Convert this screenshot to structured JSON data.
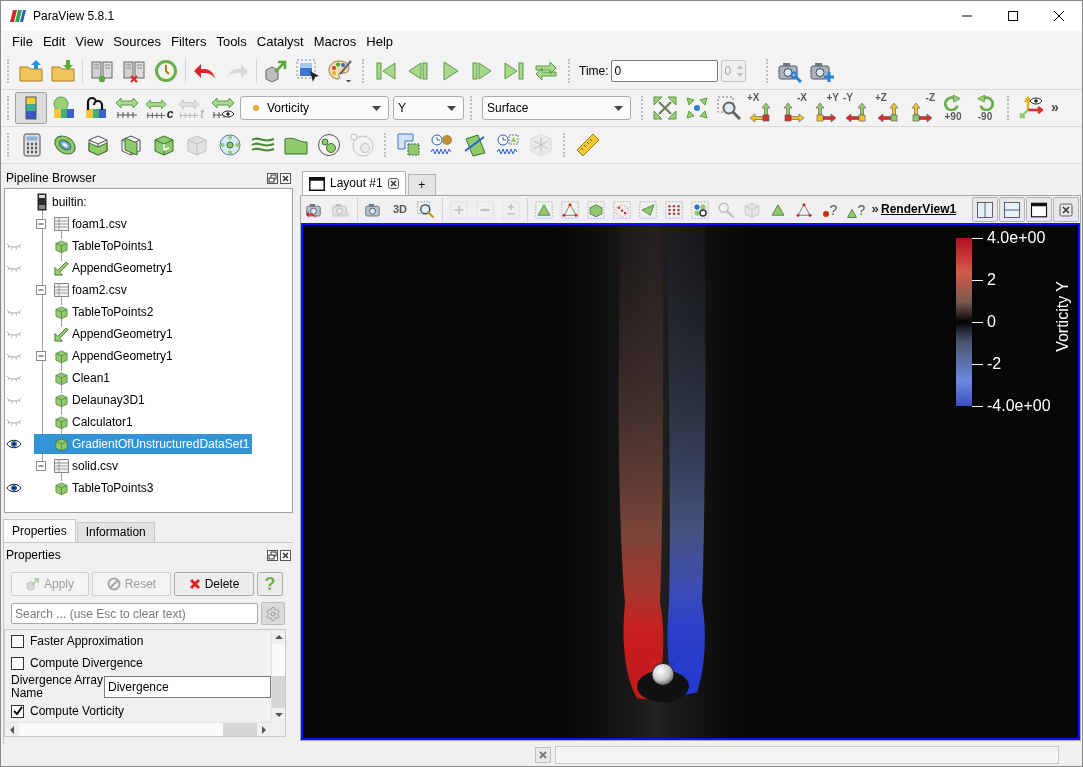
{
  "window": {
    "title": "ParaView 5.8.1"
  },
  "menu_bar": [
    "File",
    "Edit",
    "View",
    "Sources",
    "Filters",
    "Tools",
    "Catalyst",
    "Macros",
    "Help"
  ],
  "toolbar_rows": [
    {
      "toolbars": [
        {
          "groups": [
            [
              {
                "kind": "open"
              },
              {
                "kind": "save"
              }
            ],
            [
              {
                "kind": "connect"
              },
              {
                "kind": "disconnect"
              },
              {
                "kind": "autoapply"
              }
            ],
            [
              {
                "kind": "undo"
              },
              {
                "kind": "redo",
                "disabled": true
              }
            ],
            [
              {
                "kind": "export"
              },
              {
                "kind": "select"
              },
              {
                "kind": "palette"
              }
            ]
          ]
        },
        {
          "groups": [
            [
              {
                "kind": "first"
              },
              {
                "kind": "previous"
              },
              {
                "kind": "play"
              },
              {
                "kind": "next"
              },
              {
                "kind": "last"
              },
              {
                "kind": "loop"
              }
            ]
          ]
        },
        {
          "groups": [
            [
              {
                "kind": "label",
                "text": "Time:"
              },
              {
                "kind": "input",
                "value": "0"
              },
              {
                "kind": "spin",
                "value": "0",
                "disabled": true
              }
            ]
          ]
        },
        {
          "groups": [
            [
              {
                "kind": "snapshot"
              },
              {
                "kind": "snapshotadd"
              }
            ]
          ]
        }
      ]
    },
    {
      "toolbars": [
        {
          "groups": [
            [
              {
                "kind": "colormap",
                "pressed": true
              },
              {
                "kind": "legend"
              },
              {
                "kind": "editcolors"
              },
              {
                "kind": "rescale"
              },
              {
                "kind": "rescalecustom",
                "label": "c"
              },
              {
                "kind": "rescaletemporal",
                "label": "t",
                "disabled": true
              },
              {
                "kind": "rescalevisible"
              },
              {
                "kind": "array",
                "value": "Vorticity"
              },
              {
                "kind": "component",
                "value": "Y"
              }
            ]
          ]
        },
        {
          "groups": [
            [
              {
                "kind": "representation",
                "value": "Surface"
              }
            ]
          ]
        },
        {
          "groups": [
            [
              {
                "kind": "resetcamera"
              },
              {
                "kind": "zoomdata"
              },
              {
                "kind": "zoombox"
              },
              {
                "kind": "px",
                "label": "+X"
              },
              {
                "kind": "mx",
                "label": "-X"
              },
              {
                "kind": "py",
                "label": "+Y"
              },
              {
                "kind": "my",
                "label": "-Y"
              },
              {
                "kind": "pz",
                "label": "+Z"
              },
              {
                "kind": "mz",
                "label": "-Z"
              },
              {
                "kind": "rotatecw",
                "label": "+90"
              },
              {
                "kind": "rotateccw",
                "label": "-90"
              }
            ]
          ]
        },
        {
          "groups": [
            [
              {
                "kind": "axes"
              },
              {
                "kind": "more",
                "label": "»"
              }
            ]
          ]
        }
      ]
    },
    {
      "toolbars": [
        {
          "groups": [
            [
              {
                "kind": "calculator"
              },
              {
                "kind": "contour"
              },
              {
                "kind": "clip"
              },
              {
                "kind": "slice"
              },
              {
                "kind": "threshold"
              },
              {
                "kind": "subset",
                "disabled": true
              },
              {
                "kind": "glyph"
              },
              {
                "kind": "stream"
              },
              {
                "kind": "warp"
              },
              {
                "kind": "groupdata"
              },
              {
                "kind": "extractlevel",
                "disabled": true
              }
            ]
          ]
        },
        {
          "groups": [
            [
              {
                "kind": "finddata"
              },
              {
                "kind": "plottime"
              },
              {
                "kind": "plotline"
              },
              {
                "kind": "plotselection"
              },
              {
                "kind": "snowflake",
                "disabled": true
              }
            ]
          ]
        },
        {
          "groups": [
            [
              {
                "kind": "ruler"
              }
            ]
          ]
        }
      ]
    }
  ],
  "pipeline_browser": {
    "title": "Pipeline Browser",
    "items": [
      {
        "label": "builtin:",
        "kind": "server",
        "selected": false,
        "children": [
          {
            "label": "foam1.csv",
            "kind": "table",
            "selected": false,
            "expanded": true,
            "children": [
              {
                "label": "TableToPoints1",
                "kind": "filter",
                "visible": false,
                "selected": false,
                "children": [
                  {
                    "label": "AppendGeometry1",
                    "kind": "append",
                    "visible": false,
                    "selected": false
                  }
                ]
              }
            ]
          },
          {
            "label": "foam2.csv",
            "kind": "table",
            "selected": false,
            "expanded": true,
            "children": [
              {
                "label": "TableToPoints2",
                "kind": "filter",
                "visible": false,
                "selected": false,
                "children": [
                  {
                    "label": "AppendGeometry1",
                    "kind": "append",
                    "visible": false,
                    "selected": false
                  }
                ]
              }
            ]
          },
          {
            "label": "AppendGeometry1",
            "kind": "filter",
            "visible": false,
            "selected": false,
            "expanded": true,
            "children": [
              {
                "label": "Clean1",
                "kind": "filter",
                "visible": false,
                "selected": false,
                "children": [
                  {
                    "label": "Delaunay3D1",
                    "kind": "filter",
                    "visible": false,
                    "selected": false,
                    "children": [
                      {
                        "label": "Calculator1",
                        "kind": "filter",
                        "visible": false,
                        "selected": false,
                        "children": [
                          {
                            "label": "GradientOfUnstructuredDataSet1",
                            "kind": "filter",
                            "visible": true,
                            "selected": true
                          }
                        ]
                      }
                    ]
                  }
                ]
              }
            ]
          },
          {
            "label": "solid.csv",
            "kind": "table",
            "selected": false,
            "expanded": true,
            "children": [
              {
                "label": "TableToPoints3",
                "kind": "filter",
                "visible": true,
                "selected": false
              }
            ]
          }
        ]
      }
    ]
  },
  "properties_panel": {
    "tabs": [
      {
        "label": "Properties",
        "selected": true
      },
      {
        "label": "Information",
        "selected": false
      }
    ],
    "title": "Properties",
    "buttons": [
      {
        "kind": "apply",
        "label": "Apply",
        "disabled": true
      },
      {
        "kind": "reset",
        "label": "Reset",
        "disabled": true
      },
      {
        "kind": "delete",
        "label": "Delete",
        "disabled": false
      },
      {
        "kind": "help",
        "label": "?",
        "disabled": false
      }
    ],
    "search": {
      "placeholder": "Search ... (use Esc to clear text)"
    },
    "properties": [
      {
        "kind": "checkbox",
        "label": "Faster Approximation",
        "checked": false
      },
      {
        "kind": "checkbox",
        "label": "Compute Divergence",
        "checked": false
      },
      {
        "kind": "field",
        "label": "Divergence Array Name",
        "value": "Divergence"
      },
      {
        "kind": "checkbox",
        "label": "Compute Vorticity",
        "checked": true
      }
    ]
  },
  "layout_tabs": [
    {
      "kind": "layout",
      "label": "Layout #1",
      "selected": true
    },
    {
      "kind": "new",
      "label": "+",
      "selected": false
    }
  ],
  "view_toolbar": {
    "groups": [
      [
        {
          "kind": "cameraundo"
        },
        {
          "kind": "cameraredo",
          "disabled": true
        }
      ],
      [
        {
          "kind": "capture"
        },
        {
          "kind": "text",
          "label": "3D"
        },
        {
          "kind": "zoomrect"
        }
      ],
      [
        {
          "kind": "addsel",
          "disabled": true
        },
        {
          "kind": "subsel",
          "disabled": true
        },
        {
          "kind": "togglesel",
          "disabled": true
        }
      ],
      [
        {
          "kind": "selcells"
        },
        {
          "kind": "selpoints"
        },
        {
          "kind": "frustumcells"
        },
        {
          "kind": "frustumpoints"
        },
        {
          "kind": "polycells"
        },
        {
          "kind": "polypoints"
        },
        {
          "kind": "blocks"
        },
        {
          "kind": "interactive",
          "disabled": true
        },
        {
          "kind": "grow",
          "disabled": true
        },
        {
          "kind": "selcellsinter"
        },
        {
          "kind": "selpointsinter"
        },
        {
          "kind": "hoverpoints",
          "label": "?"
        },
        {
          "kind": "hovercells",
          "label": "?"
        }
      ]
    ],
    "more": "»",
    "view_name": "RenderView1",
    "view_buttons": [
      {
        "kind": "splith"
      },
      {
        "kind": "splitv"
      },
      {
        "kind": "maximize"
      },
      {
        "kind": "closeview"
      }
    ]
  },
  "render_view": {
    "legend": {
      "title": "Vorticity Y",
      "labels": [
        "4.0e+00",
        "2",
        "0",
        "-2",
        "-4.0e+00"
      ]
    }
  }
}
